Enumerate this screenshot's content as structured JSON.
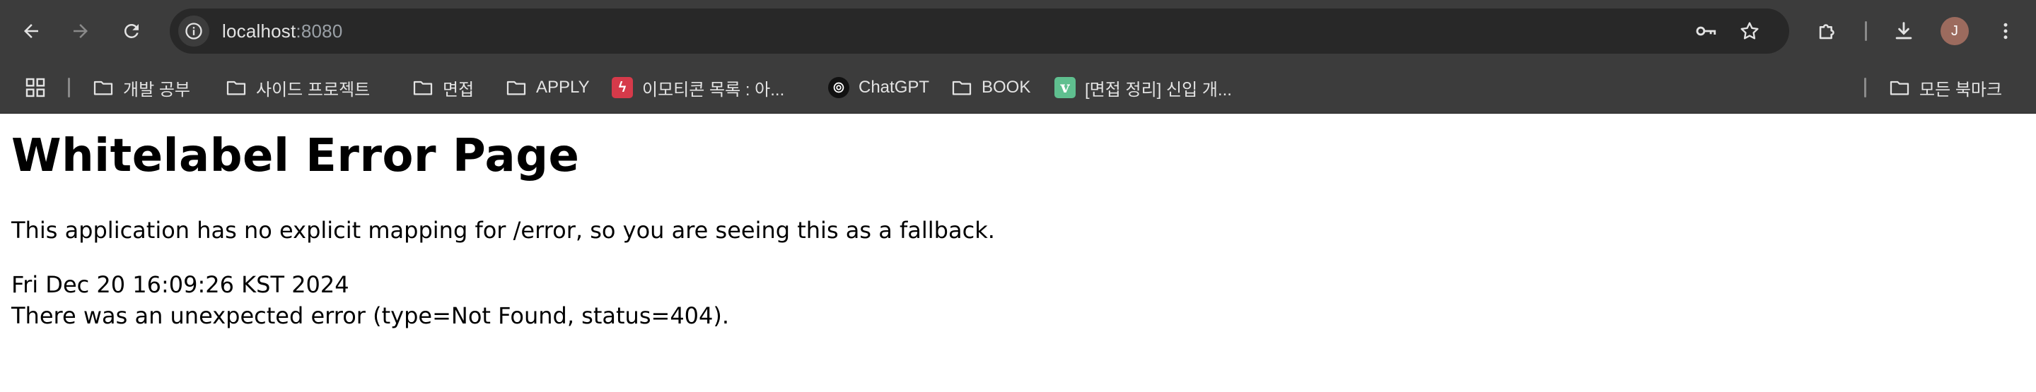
{
  "browser": {
    "omnibox": {
      "host": "localhost",
      "port": ":8080"
    },
    "profile_initial": "J",
    "bookmarks": [
      {
        "label": "개발 공부",
        "icon": "folder-icon"
      },
      {
        "label": "사이드 프로젝트",
        "icon": "folder-icon"
      },
      {
        "label": "면접",
        "icon": "folder-icon"
      },
      {
        "label": "APPLY",
        "icon": "folder-icon"
      },
      {
        "label": "이모티콘 목록 : 아...",
        "icon": "red-favicon"
      },
      {
        "label": "ChatGPT",
        "icon": "chatgpt-favicon"
      },
      {
        "label": "BOOK",
        "icon": "folder-icon"
      },
      {
        "label": "[면접 정리] 신입 개...",
        "icon": "velog-favicon"
      }
    ],
    "all_bookmarks_label": "모든 북마크",
    "favicon_letters": {
      "red": "ϟ",
      "velog": "v"
    }
  },
  "page": {
    "title": "Whitelabel Error Page",
    "message": "This application has no explicit mapping for /error, so you are seeing this as a fallback.",
    "timestamp": "Fri Dec 20 16:09:26 KST 2024",
    "error": "There was an unexpected error (type=Not Found, status=404)."
  },
  "colors": {
    "toolbar_bg": "#3c3c3c",
    "omnibox_bg": "#282828",
    "toolbar_text": "#e3e3e3",
    "page_bg": "#ffffff"
  }
}
